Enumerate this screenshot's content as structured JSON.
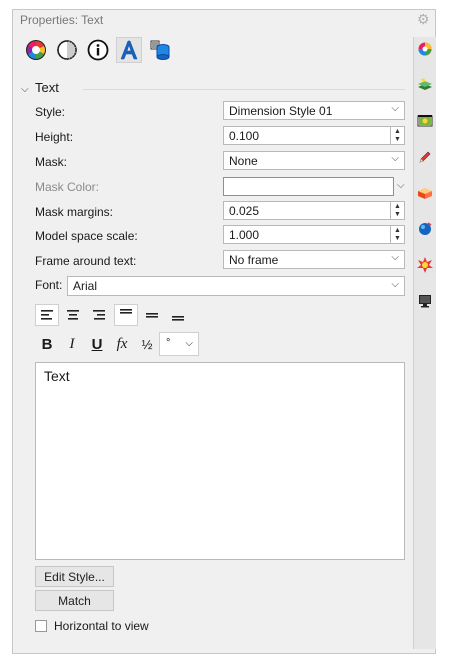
{
  "panel": {
    "title": "Properties: Text",
    "gear_icon": "gear-icon"
  },
  "toolbar": {
    "icons": [
      "color-wheel-icon",
      "shading-icon",
      "info-icon",
      "text-icon",
      "database-icon"
    ]
  },
  "section": {
    "label": "Text"
  },
  "fields": {
    "style": {
      "label": "Style:",
      "value": "Dimension Style 01"
    },
    "height": {
      "label": "Height:",
      "value": "0.100"
    },
    "mask": {
      "label": "Mask:",
      "value": "None"
    },
    "mask_color": {
      "label": "Mask Color:",
      "value": ""
    },
    "mask_margins": {
      "label": "Mask margins:",
      "value": "0.025"
    },
    "model_space_scale": {
      "label": "Model space scale:",
      "value": "1.000"
    },
    "frame": {
      "label": "Frame around text:",
      "value": "No frame"
    },
    "font": {
      "label": "Font:",
      "value": "Arial"
    }
  },
  "format": {
    "bold": "B",
    "italic": "I",
    "underline": "U",
    "function": "fx",
    "fraction": "½",
    "symbol": "°"
  },
  "text_content": "Text",
  "buttons": {
    "edit_style": "Edit Style...",
    "match": "Match"
  },
  "checkbox": {
    "horizontal_label": "Horizontal to view",
    "checked": false
  },
  "side_tabs": [
    "color-wheel-icon",
    "layer-icon",
    "display-icon",
    "pencil-icon",
    "box-icon",
    "sphere-icon",
    "sun-icon",
    "monitor-icon"
  ]
}
